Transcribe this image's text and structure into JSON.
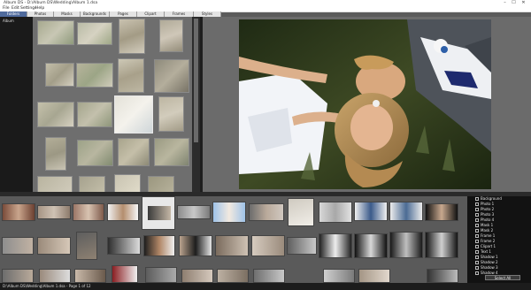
{
  "window": {
    "title": "Album DS  -  D:\\Album DS\\Wedding\\Album 1.dsa",
    "controls": [
      "–",
      "☐",
      "✕"
    ]
  },
  "menu": [
    "File",
    "Edit",
    "Settings",
    "Help"
  ],
  "tabs": [
    {
      "label": "Folders",
      "active": true
    },
    {
      "label": "Photos",
      "active": false
    },
    {
      "label": "Masks",
      "active": false
    },
    {
      "label": "Backgrounds",
      "active": false
    },
    {
      "label": "Pages",
      "active": false
    },
    {
      "label": "Clipart",
      "active": false
    },
    {
      "label": "Frames",
      "active": false
    },
    {
      "label": "Styles",
      "active": false
    },
    {
      "label": "Text",
      "active": false
    }
  ],
  "tree": {
    "root": "Album"
  },
  "layers": {
    "items": [
      "Background",
      "Photo 1",
      "Photo 2",
      "Photo 3",
      "Photo 4",
      "Mask 1",
      "Mask 2",
      "Frame 1",
      "Frame 2",
      "Clipart 1",
      "Text 1",
      "Shadow 1",
      "Shadow 2",
      "Shadow 3",
      "Shadow 4"
    ],
    "button": "Select All"
  },
  "status": {
    "text": "D:\\Album DS\\Wedding\\Album 1.dsa  -  Page 1 of 12"
  },
  "colors": {
    "accent": "#4f6a9c",
    "panel": "#6e6e6e",
    "dark": "#121212"
  }
}
